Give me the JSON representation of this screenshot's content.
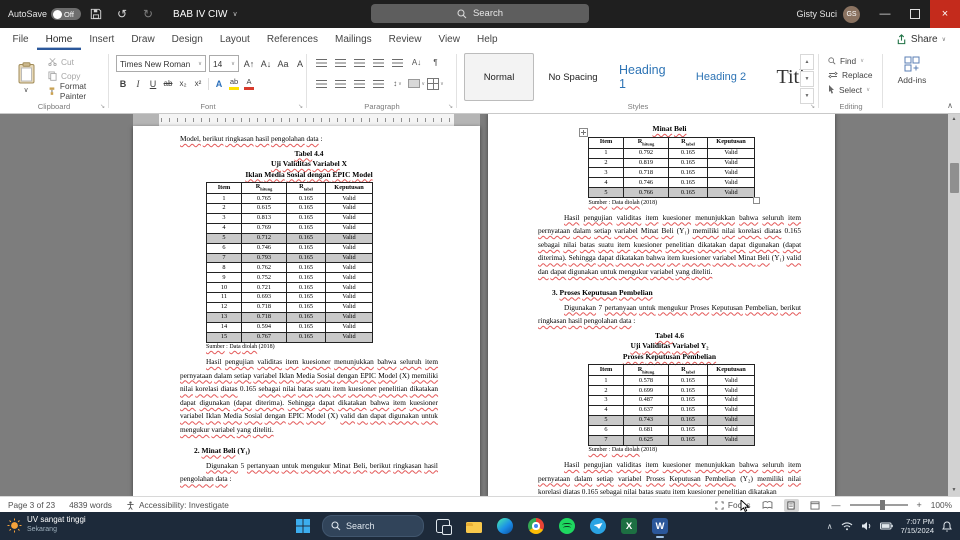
{
  "titlebar": {
    "autosave_label": "AutoSave",
    "autosave_state": "Off",
    "doc_title": "BAB IV CIW",
    "search_placeholder": "Search",
    "user_name": "Gisty Suci",
    "user_initials": "GS"
  },
  "icons": {
    "undo": "↺",
    "redo": "↻",
    "chevron_down": "∨",
    "chevron_up": "∧",
    "launcher": "↘",
    "minimize": "—",
    "close": "×",
    "pilcrow": "¶",
    "sort": "A↓",
    "grow_font": "A↑",
    "shrink_font": "A↓",
    "change_case": "Aa",
    "clear_format": "A",
    "line_spacing": "↕",
    "up_triangle": "▲",
    "down_triangle": "▼"
  },
  "ribbon": {
    "tabs": [
      "File",
      "Home",
      "Insert",
      "Draw",
      "Design",
      "Layout",
      "References",
      "Mailings",
      "Review",
      "View",
      "Help"
    ],
    "active_tab": "Home",
    "share_label": "Share",
    "groups": {
      "clipboard": {
        "label": "Clipboard",
        "paste": "Paste",
        "cut": "Cut",
        "copy": "Copy",
        "format_painter": "Format Painter"
      },
      "font": {
        "label": "Font",
        "family": "Times New Roman",
        "size": "14",
        "bold": "B",
        "italic": "I",
        "underline": "U",
        "strike": "ab",
        "subscript": "x₂",
        "superscript": "x²",
        "effects": "A",
        "highlight": "ab",
        "font_color": "A"
      },
      "paragraph": {
        "label": "Paragraph"
      },
      "styles": {
        "label": "Styles",
        "items": [
          "Normal",
          "No Spacing",
          "Heading 1",
          "Heading 2",
          "Title"
        ]
      },
      "editing": {
        "label": "Editing",
        "find": "Find",
        "replace": "Replace",
        "select": "Select"
      },
      "addins": {
        "label": "Add-ins"
      }
    }
  },
  "document": {
    "pages": [
      {
        "blocks": [
          {
            "type": "para",
            "cls": "lead",
            "spell": true,
            "text": "Model, berikut ringkasan hasil pengolahan data :"
          },
          {
            "type": "caption",
            "spell": true,
            "lines": [
              "Tabel 4.4",
              "Uji Validitas Variabel X",
              "Iklan Media Sosial dengan EPIC Model"
            ]
          },
          {
            "type": "table",
            "align": "left",
            "headers": [
              {
                "t": "Item"
              },
              {
                "t": "R",
                "sub": "hitung"
              },
              {
                "t": "R",
                "sub": "tabel"
              },
              {
                "t": "Keputusan"
              }
            ],
            "rows": [
              [
                "1",
                "0.765",
                "0.165",
                "Valid"
              ],
              [
                "2",
                "0.615",
                "0.165",
                "Valid"
              ],
              [
                "3",
                "0.813",
                "0.165",
                "Valid"
              ],
              [
                "4",
                "0.769",
                "0.165",
                "Valid"
              ],
              [
                "5",
                "0.712",
                "0.165",
                "Valid"
              ],
              [
                "6",
                "0.746",
                "0.165",
                "Valid"
              ],
              [
                "7",
                "0.793",
                "0.165",
                "Valid"
              ],
              [
                "8",
                "0.762",
                "0.165",
                "Valid"
              ],
              [
                "9",
                "0.752",
                "0.165",
                "Valid"
              ],
              [
                "10",
                "0.721",
                "0.165",
                "Valid"
              ],
              [
                "11",
                "0.693",
                "0.165",
                "Valid"
              ],
              [
                "12",
                "0.718",
                "0.165",
                "Valid"
              ],
              [
                "13",
                "0.718",
                "0.165",
                "Valid"
              ],
              [
                "14",
                "0.594",
                "0.165",
                "Valid"
              ],
              [
                "15",
                "0.767",
                "0.165",
                "Valid"
              ]
            ],
            "shaded": [
              4,
              6,
              12,
              14
            ]
          },
          {
            "type": "source",
            "text": "Sumber : Data diolah (2018)"
          },
          {
            "type": "para",
            "indent": true,
            "spell": true,
            "text": "Hasil pengujian validitas item kuesioner menunjukkan bahwa seluruh item pernyataan dalam setiap variabel Iklan Media Sosial dengan EPIC Model (X) memiliki nilai korelasi diatas 0.165 sebagai nilai batas suatu item kuesioner penelitian dikatakan dapat digunakan (dapat diterima). Sehingga dapat dikatakan bahwa item kuesioner variabel Iklan Media Sosial dengan EPIC Model (X) valid dan dapat digunakan untuk mengukur variabel yang diteliti."
          },
          {
            "type": "heading",
            "spell": true,
            "text": "2.  Minat Beli (Y₁)"
          },
          {
            "type": "para",
            "indent": true,
            "spell": true,
            "text": "Digunakan 5 pertanyaan untuk mengukur Minat Beli, berikut ringkasan hasil pengolahan data :"
          }
        ]
      },
      {
        "blocks": [
          {
            "type": "caption",
            "spell": true,
            "lines": [
              "Minat Beli"
            ]
          },
          {
            "type": "table",
            "align": "center",
            "handles": true,
            "headers": [
              {
                "t": "Item"
              },
              {
                "t": "R",
                "sub": "hitung"
              },
              {
                "t": "R",
                "sub": "tabel"
              },
              {
                "t": "Keputusan"
              }
            ],
            "rows": [
              [
                "1",
                "0.792",
                "0.165",
                "Valid"
              ],
              [
                "2",
                "0.819",
                "0.165",
                "Valid"
              ],
              [
                "3",
                "0.718",
                "0.165",
                "Valid"
              ],
              [
                "4",
                "0.746",
                "0.165",
                "Valid"
              ],
              [
                "5",
                "0.766",
                "0.165",
                "Valid"
              ]
            ],
            "shaded": [
              4
            ]
          },
          {
            "type": "source",
            "text": "Sumber : Data diolah (2018)"
          },
          {
            "type": "para",
            "indent": true,
            "spell": true,
            "text": "Hasil pengujian validitas item kuesioner menunjukkan bahwa seluruh item pernyataan dalam setiap variabel Minat Beli (Y₁) memiliki nilai korelasi diatas 0.165 sebagai nilai batas suatu item kuesioner penelitian dikatakan dapat digunakan (dapat diterima). Sehingga dapat dikatakan bahwa item kuesioner variabel Minat Beli (Y₁) valid dan dapat digunakan untuk mengukur variabel yang diteliti."
          },
          {
            "type": "heading",
            "spell": true,
            "text": "3.  Proses Keputusan Pembelian"
          },
          {
            "type": "para",
            "indent": true,
            "spell": true,
            "text": "Digunakan 7 pertanyaan untuk mengukur Proses Keputusan Pembelian, berikut ringkasan hasil pengolahan data :"
          },
          {
            "type": "caption",
            "spell": true,
            "lines": [
              "Tabel 4.6",
              "Uji Validitas Variabel Y₂",
              "Proses Keputusan Pembelian"
            ]
          },
          {
            "type": "table",
            "align": "center",
            "headers": [
              {
                "t": "Item"
              },
              {
                "t": "R",
                "sub": "hitung"
              },
              {
                "t": "R",
                "sub": "tabel"
              },
              {
                "t": "Keputusan"
              }
            ],
            "rows": [
              [
                "1",
                "0.578",
                "0.165",
                "Valid"
              ],
              [
                "2",
                "0.699",
                "0.165",
                "Valid"
              ],
              [
                "3",
                "0.487",
                "0.165",
                "Valid"
              ],
              [
                "4",
                "0.637",
                "0.165",
                "Valid"
              ],
              [
                "5",
                "0.743",
                "0.165",
                "Valid"
              ],
              [
                "6",
                "0.681",
                "0.165",
                "Valid"
              ],
              [
                "7",
                "0.625",
                "0.165",
                "Valid"
              ]
            ],
            "shaded": [
              4,
              6
            ]
          },
          {
            "type": "source",
            "text": "Sumber : Data diolah (2018)"
          },
          {
            "type": "para",
            "indent": true,
            "spell": true,
            "text": "Hasil pengujian validitas item kuesioner menunjukkan bahwa seluruh item pernyataan dalam setiap variabel Proses Keputusan Pembelian (Y₂) memiliki nilai korelasi diatas 0.165 sebagai nilai batas suatu item kuesioner penelitian dikatakan"
          }
        ]
      }
    ]
  },
  "statusbar": {
    "page": "Page 3 of 23",
    "words": "4839 words",
    "accessibility": "Accessibility: Investigate",
    "focus": "Focus",
    "zoom": "100%"
  },
  "taskbar": {
    "widget_line1": "UV sangat tinggi",
    "widget_line2": "Sekarang",
    "search_label": "Search",
    "apps": [
      {
        "name": "task-view"
      },
      {
        "name": "file-explorer"
      },
      {
        "name": "edge"
      },
      {
        "name": "chrome"
      },
      {
        "name": "spotify"
      },
      {
        "name": "telegram"
      },
      {
        "name": "excel",
        "glyph": "X"
      },
      {
        "name": "word",
        "glyph": "W",
        "active": true
      }
    ],
    "clock_time": "7:07 PM",
    "clock_date": "7/15/2024"
  }
}
